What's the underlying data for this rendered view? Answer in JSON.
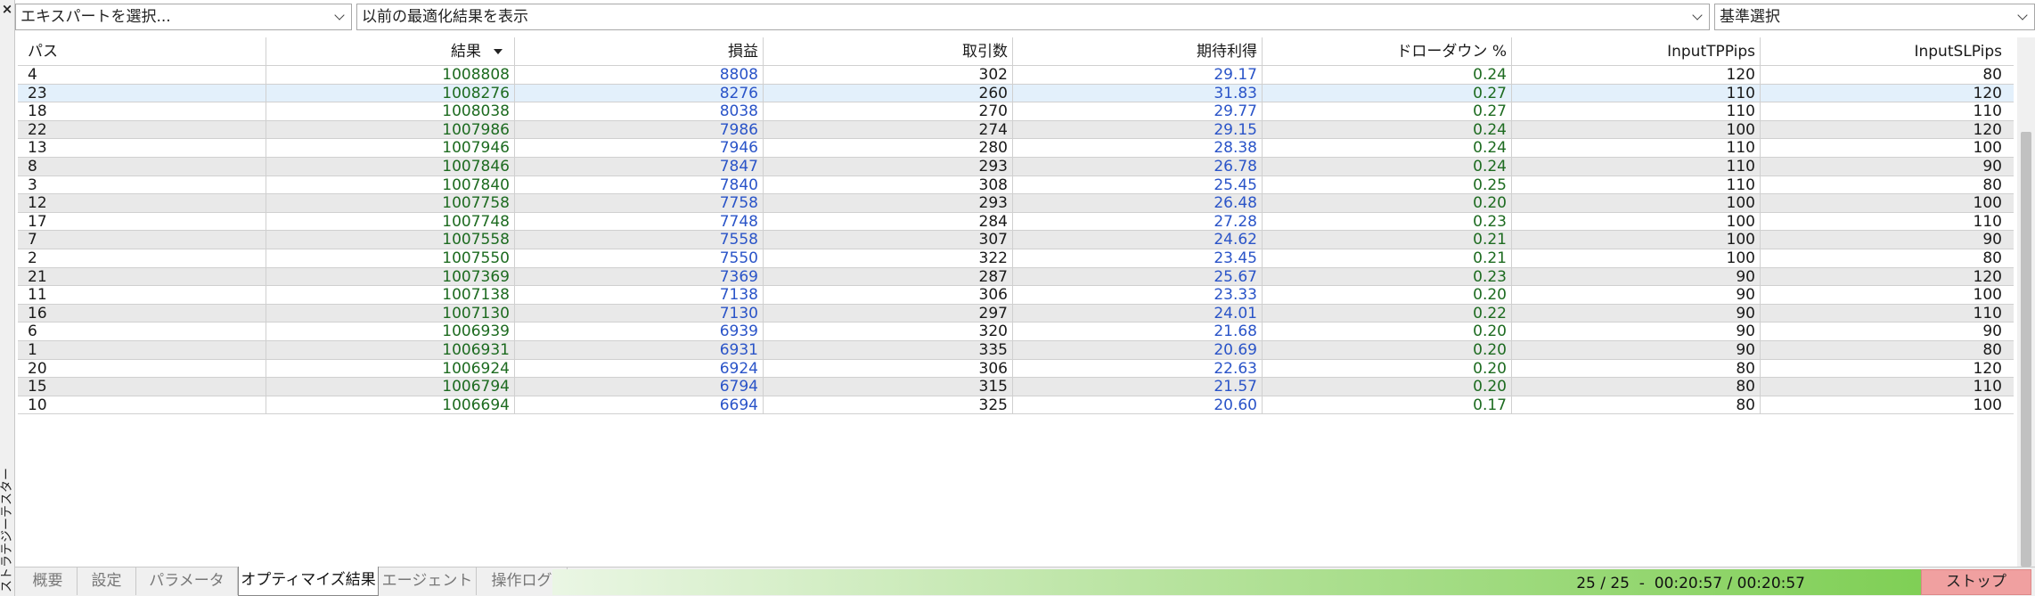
{
  "side": {
    "close": "×",
    "title": "ストラテジーテスター"
  },
  "selectors": {
    "expert": "エキスパートを選択...",
    "previous": "以前の最適化結果を表示",
    "criterion": "基準選択"
  },
  "columns": [
    "パス",
    "結果",
    "損益",
    "取引数",
    "期待利得",
    "ドローダウン %",
    "InputTPPips",
    "InputSLPips"
  ],
  "rows": [
    [
      "4",
      "1008808",
      "8808",
      "302",
      "29.17",
      "0.24",
      "120",
      "80"
    ],
    [
      "23",
      "1008276",
      "8276",
      "260",
      "31.83",
      "0.27",
      "110",
      "120"
    ],
    [
      "18",
      "1008038",
      "8038",
      "270",
      "29.77",
      "0.27",
      "110",
      "110"
    ],
    [
      "22",
      "1007986",
      "7986",
      "274",
      "29.15",
      "0.24",
      "100",
      "120"
    ],
    [
      "13",
      "1007946",
      "7946",
      "280",
      "28.38",
      "0.24",
      "110",
      "100"
    ],
    [
      "8",
      "1007846",
      "7847",
      "293",
      "26.78",
      "0.24",
      "110",
      "90"
    ],
    [
      "3",
      "1007840",
      "7840",
      "308",
      "25.45",
      "0.25",
      "110",
      "80"
    ],
    [
      "12",
      "1007758",
      "7758",
      "293",
      "26.48",
      "0.20",
      "100",
      "100"
    ],
    [
      "17",
      "1007748",
      "7748",
      "284",
      "27.28",
      "0.23",
      "100",
      "110"
    ],
    [
      "7",
      "1007558",
      "7558",
      "307",
      "24.62",
      "0.21",
      "100",
      "90"
    ],
    [
      "2",
      "1007550",
      "7550",
      "322",
      "23.45",
      "0.21",
      "100",
      "80"
    ],
    [
      "21",
      "1007369",
      "7369",
      "287",
      "25.67",
      "0.23",
      "90",
      "120"
    ],
    [
      "11",
      "1007138",
      "7138",
      "306",
      "23.33",
      "0.20",
      "90",
      "100"
    ],
    [
      "16",
      "1007130",
      "7130",
      "297",
      "24.01",
      "0.22",
      "90",
      "110"
    ],
    [
      "6",
      "1006939",
      "6939",
      "320",
      "21.68",
      "0.20",
      "90",
      "90"
    ],
    [
      "1",
      "1006931",
      "6931",
      "335",
      "20.69",
      "0.20",
      "90",
      "80"
    ],
    [
      "20",
      "1006924",
      "6924",
      "306",
      "22.63",
      "0.20",
      "80",
      "120"
    ],
    [
      "15",
      "1006794",
      "6794",
      "315",
      "21.57",
      "0.20",
      "80",
      "110"
    ],
    [
      "10",
      "1006694",
      "6694",
      "325",
      "20.60",
      "0.17",
      "80",
      "100"
    ]
  ],
  "selected_row": 1,
  "tabs": [
    "概要",
    "設定",
    "パラメータ",
    "オプティマイズ結果",
    "エージェント",
    "操作ログ"
  ],
  "active_tab": 3,
  "status": {
    "progress_text": "25 / 25  -  00:20:57 / 00:20:57",
    "progress_fraction": 1.0
  },
  "stop_button": "ストップ",
  "colors": {
    "green": "#1d6b20",
    "blue": "#2a54c8",
    "progress": "#7fcf55",
    "stop": "#f0a0a0"
  }
}
